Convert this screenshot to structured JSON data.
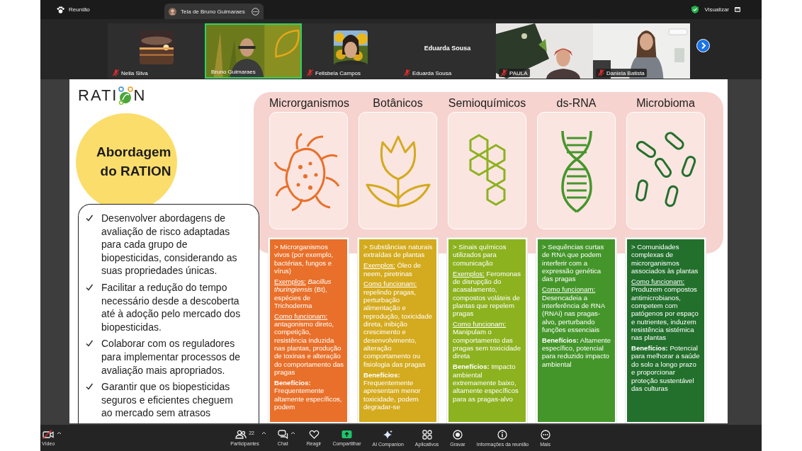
{
  "top_bar": {
    "meeting": "Reunião",
    "share_tab": "Tela de Bruno Guimaraes",
    "view_button": "Visualizar"
  },
  "participants": [
    {
      "name": "Nelia Silva",
      "kind": "avatar",
      "muted": true,
      "selected": false
    },
    {
      "name": "Bruno Guimaraes",
      "kind": "video",
      "muted": false,
      "selected": true
    },
    {
      "name": "Felisbela Campos",
      "kind": "avatar",
      "muted": true,
      "selected": false
    },
    {
      "name": "Eduarda Sousa",
      "kind": "name",
      "display_name": "Eduarda Sousa",
      "muted": true,
      "selected": false
    },
    {
      "name": "PAULA",
      "kind": "video",
      "muted": true,
      "selected": false
    },
    {
      "name": "Daniela Batista",
      "kind": "video",
      "muted": true,
      "selected": false
    }
  ],
  "slide": {
    "logo": [
      "RATI",
      "N"
    ],
    "heading": "Abordagem do RATION",
    "goals": [
      "Desenvolver abordagens de avaliação de risco adaptadas para cada grupo de biopesticidas, considerando as suas propriedades únicas.",
      "Facilitar a redução do tempo necessário desde a descoberta até à adoção pelo mercado dos biopesticidas.",
      "Colaborar com os reguladores para implementar processos de avaliação mais apropriados.",
      "Garantir que os biopesticidas seguros e eficientes cheguem ao mercado sem atrasos"
    ],
    "groups": [
      {
        "title": "Microrganismos",
        "kind": "bacterium",
        "color": "#e8702a",
        "paragraphs": [
          {
            "kind": "plain",
            "text": "> Microrganismos vivos (por exemplo, bactérias, fungos e vírus)"
          },
          {
            "kind": "underlined",
            "label": "Exemplos:",
            "text": "*Bacillus thuringiensis* (Bt), espécies de Trichoderma"
          },
          {
            "kind": "underlined",
            "label": "Como funcionam:",
            "text": "antagonismo direto, competição, resistência induzida nas plantas, produção de toxinas e alteração do comportamento das pragas"
          },
          {
            "kind": "bold",
            "label": "Benefícios:",
            "text": "Frequentemente altamente específicos, podem"
          }
        ]
      },
      {
        "title": "Botânicos",
        "kind": "tulip",
        "color": "#d4aa1e",
        "paragraphs": [
          {
            "kind": "plain",
            "text": "> Substâncias naturais extraídas de plantas"
          },
          {
            "kind": "underlined",
            "label": "Exemplos:",
            "text": "Óleo de neem, piretrinas"
          },
          {
            "kind": "underlined",
            "label": "Como funcionam:",
            "text": "repelindo pragas, perturbação alimentação e reprodução, toxicidade direta, inibição crescimento e desenvolvimento, alteração comportamento ou fisiologia das pragas"
          },
          {
            "kind": "bold",
            "label": "Benefícios:",
            "text": "Frequentemente apresentam menor toxicidade, podem degradar-se"
          }
        ]
      },
      {
        "title": "Semioquímicos",
        "kind": "hexagons",
        "color": "#8cb21f",
        "paragraphs": [
          {
            "kind": "plain",
            "text": "> Sinais químicos utilizados para comunicação"
          },
          {
            "kind": "underlined",
            "label": "Exemplos:",
            "text": "Feromonas de disrupção do acasalamento, compostos voláteis de plantas que repelem pragas"
          },
          {
            "kind": "underlined",
            "label": "Como funcionam:",
            "text": "Manipulam o comportamento das pragas sem toxicidade direta"
          },
          {
            "kind": "bold",
            "label": "Benefícios:",
            "text": "Impacto ambiental extremamente baixo, altamente específicos para as pragas-alvo"
          }
        ]
      },
      {
        "title": "ds-RNA",
        "kind": "dna",
        "color": "#45962a",
        "paragraphs": [
          {
            "kind": "plain",
            "text": "> Sequências curtas de RNA que podem interferir com a expressão genética das pragas"
          },
          {
            "kind": "underlined",
            "label": "Como funcionam:",
            "text": "Desencadeia a interferência de RNA (RNAi) nas pragas-alvo, perturbando funções essenciais"
          },
          {
            "kind": "bold",
            "label": "Benefícios:",
            "text": "Altamente específico, potencial para reduzido impacto ambiental"
          }
        ]
      },
      {
        "title": "Microbioma",
        "kind": "capsules",
        "color": "#23702c",
        "paragraphs": [
          {
            "kind": "plain",
            "text": "> Comunidades complexas de microrganismos associados às plantas"
          },
          {
            "kind": "underlined",
            "label": "Como funcionam:",
            "text": "Produzem compostos antimicrobianos, competem com patógenos por espaço e nutrientes, induzem resistência sistémica nas plantas"
          },
          {
            "kind": "bold",
            "label": "Benefícios:",
            "text": "Potencial para melhorar a saúde do solo a longo prazo e proporcionar proteção sustentável das culturas"
          }
        ]
      }
    ]
  },
  "toolbar": [
    {
      "kind": "video",
      "label": "Vídeo",
      "menu": true
    },
    {
      "kind": "participants",
      "label": "Participantes",
      "count": "22",
      "menu": true
    },
    {
      "kind": "chat",
      "label": "Chat",
      "menu": true
    },
    {
      "kind": "react",
      "label": "Reagir",
      "menu": false
    },
    {
      "kind": "share",
      "label": "Compartilhar",
      "menu": false
    },
    {
      "kind": "ai",
      "label": "AI Companion",
      "menu": false
    },
    {
      "kind": "apps",
      "label": "Aplicativos",
      "menu": false
    },
    {
      "kind": "record",
      "label": "Gravar",
      "menu": false
    },
    {
      "kind": "info",
      "label": "Informações da reunião",
      "menu": false
    },
    {
      "kind": "more",
      "label": "Mais",
      "menu": false
    }
  ]
}
